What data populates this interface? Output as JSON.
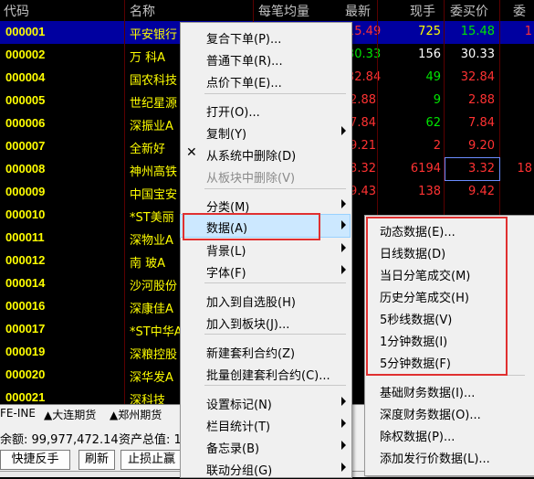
{
  "table": {
    "headers": {
      "code": "代码",
      "name": "名称",
      "avg": "每笔均量",
      "last": "最新",
      "vol": "现手",
      "bid": "委买价",
      "ask": "委"
    },
    "rows": [
      {
        "code": "000001",
        "name": "平安银行",
        "last": "15.49",
        "vol": "725",
        "bid": "15.48",
        "extra": "1"
      },
      {
        "code": "000002",
        "name": "万  科A",
        "last": "30.33",
        "vol": "156",
        "bid": "30.33",
        "extra": ""
      },
      {
        "code": "000004",
        "name": "国农科技",
        "last": "32.84",
        "vol": "49",
        "bid": "32.84",
        "extra": ""
      },
      {
        "code": "000005",
        "name": "世纪星源",
        "last": "2.88",
        "vol": "9",
        "bid": "2.88",
        "extra": ""
      },
      {
        "code": "000006",
        "name": "深振业A",
        "last": "7.84",
        "vol": "62",
        "bid": "7.84",
        "extra": ""
      },
      {
        "code": "000007",
        "name": "全新好",
        "last": "9.21",
        "vol": "2",
        "bid": "9.20",
        "extra": ""
      },
      {
        "code": "000008",
        "name": "神州高铁",
        "last": "3.32",
        "vol": "6194",
        "bid": "3.32",
        "extra": "18"
      },
      {
        "code": "000009",
        "name": "中国宝安",
        "last": "9.43",
        "vol": "138",
        "bid": "9.42",
        "extra": ""
      },
      {
        "code": "000010",
        "name": "*ST美丽",
        "last": "",
        "vol": "",
        "bid": "",
        "extra": ""
      },
      {
        "code": "000011",
        "name": "深物业A",
        "last": "",
        "vol": "",
        "bid": "",
        "extra": ""
      },
      {
        "code": "000012",
        "name": "南  玻A",
        "last": "",
        "vol": "",
        "bid": "",
        "extra": ""
      },
      {
        "code": "000014",
        "name": "沙河股份",
        "last": "",
        "vol": "",
        "bid": "",
        "extra": ""
      },
      {
        "code": "000016",
        "name": "深康佳A",
        "last": "",
        "vol": "",
        "bid": "",
        "extra": ""
      },
      {
        "code": "000017",
        "name": "*ST中华A",
        "last": "",
        "vol": "",
        "bid": "",
        "extra": ""
      },
      {
        "code": "000019",
        "name": "深粮控股",
        "last": "",
        "vol": "",
        "bid": "",
        "extra": ""
      },
      {
        "code": "000020",
        "name": "深华发A",
        "last": "",
        "vol": "",
        "bid": "",
        "extra": ""
      },
      {
        "code": "000021",
        "name": "深科技",
        "last": "",
        "vol": "",
        "bid": "",
        "extra": ""
      }
    ]
  },
  "tabs": {
    "t1": "FE-INE",
    "t2": "大连期货",
    "t3": "郑州期货",
    "t4": "自"
  },
  "account": {
    "balance_label": "余额: 99,977,472.14",
    "assets_label": "资产总值: 1"
  },
  "buttons": {
    "quick_reverse": "快捷反手",
    "refresh": "刷新",
    "stop": "止损止赢"
  },
  "context_menu": {
    "items": [
      {
        "label": "复合下单(P)...",
        "disabled": false,
        "submenu": false
      },
      {
        "label": "普通下单(R)...",
        "disabled": false,
        "submenu": false
      },
      {
        "label": "点价下单(E)...",
        "disabled": false,
        "submenu": false
      },
      {
        "label": "打开(O)...",
        "disabled": false,
        "submenu": false
      },
      {
        "label": "复制(Y)",
        "disabled": false,
        "submenu": true
      },
      {
        "label": "从系统中删除(D)",
        "disabled": false,
        "submenu": false
      },
      {
        "label": "从板块中删除(V)",
        "disabled": true,
        "submenu": false
      },
      {
        "label": "分类(M)",
        "disabled": false,
        "submenu": true
      },
      {
        "label": "数据(A)",
        "disabled": false,
        "submenu": true
      },
      {
        "label": "背景(L)",
        "disabled": false,
        "submenu": true
      },
      {
        "label": "字体(F)",
        "disabled": false,
        "submenu": true
      },
      {
        "label": "加入到自选股(H)",
        "disabled": false,
        "submenu": false
      },
      {
        "label": "加入到板块(J)...",
        "disabled": false,
        "submenu": false
      },
      {
        "label": "新建套利合约(Z)",
        "disabled": false,
        "submenu": false
      },
      {
        "label": "批量创建套利合约(C)...",
        "disabled": false,
        "submenu": false
      },
      {
        "label": "设置标记(N)",
        "disabled": false,
        "submenu": true
      },
      {
        "label": "栏目统计(T)",
        "disabled": false,
        "submenu": true
      },
      {
        "label": "备忘录(B)",
        "disabled": false,
        "submenu": true
      },
      {
        "label": "联动分组(G)",
        "disabled": false,
        "submenu": true
      }
    ]
  },
  "data_submenu": {
    "items": [
      "动态数据(E)...",
      "日线数据(D)",
      "当日分笔成交(M)",
      "历史分笔成交(H)",
      "5秒线数据(V)",
      "1分钟数据(I)",
      "5分钟数据(F)",
      "基础财务数据(I)...",
      "深度财务数据(O)...",
      "除权数据(P)...",
      "添加发行价数据(L)..."
    ]
  },
  "colors": {
    "highlight": "#cce8ff",
    "annotation_red": "#e03030",
    "selected_row": "#0000a0"
  }
}
